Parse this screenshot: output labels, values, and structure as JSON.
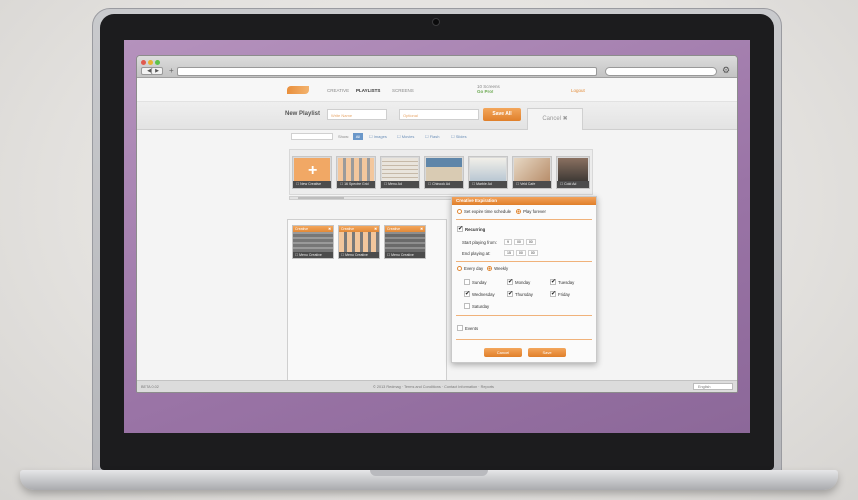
{
  "browser": {
    "nav_back": "◀",
    "nav_forward": "▶",
    "new_tab": "+",
    "settings_icon": "⚙"
  },
  "app_nav": {
    "items": [
      "CREATIVE",
      "PLAYLISTS",
      "SCREENS"
    ],
    "active": "PLAYLISTS",
    "user_line1": "10 Screens",
    "user_line2": "Go Pro!",
    "logout": "Logout"
  },
  "playlist_bar": {
    "label": "New Playlist",
    "name_placeholder": "Write Name",
    "desc_placeholder": "Optional",
    "save_label": "Save All",
    "cancel_label": "Cancel ✖"
  },
  "filter": {
    "search_placeholder": "Search",
    "show_label": "Show:",
    "all_label": "All",
    "items": [
      "☐ Images",
      "☐ Movies",
      "☐ Flash",
      "☐ Slides"
    ]
  },
  "thumbnails": [
    {
      "caption": "☐ New Creative",
      "kind": "add"
    },
    {
      "caption": "☐ 16 Spectre Grid",
      "kind": "grid"
    },
    {
      "caption": "☐ Menu Ad",
      "kind": "menu"
    },
    {
      "caption": "☐ Chinook Ad",
      "kind": "photo"
    },
    {
      "caption": "☐ Marble Ad",
      "kind": "text"
    },
    {
      "caption": "☐ Veld Cafe",
      "kind": "photo2"
    },
    {
      "caption": "☐ Cold Ad",
      "kind": "dark"
    }
  ],
  "playlist_tiles": [
    {
      "title": "Creative",
      "caption": "☐ Menu Creative"
    },
    {
      "title": "Creative",
      "caption": "☐ Menu Creative"
    },
    {
      "title": "Creative",
      "caption": "☐ Menu Creative"
    }
  ],
  "dialog": {
    "title": "Creative Expiration",
    "opt_expire": "Set expire time schedule",
    "opt_forever": "Play forever",
    "recurring": "Recurring",
    "start_label": "Start playing from:",
    "start_h": "9",
    "start_m": "00",
    "start_s": "00",
    "end_label": "End playing at:",
    "end_h": "15",
    "end_m": "00",
    "end_s": "00",
    "every_day": "Every day",
    "weekly": "Weekly",
    "days": [
      {
        "name": "Sunday",
        "checked": false
      },
      {
        "name": "Monday",
        "checked": true
      },
      {
        "name": "Tuesday",
        "checked": true
      },
      {
        "name": "Wednesday",
        "checked": true
      },
      {
        "name": "Thursday",
        "checked": true
      },
      {
        "name": "Friday",
        "checked": true
      },
      {
        "name": "Saturday",
        "checked": false
      }
    ],
    "events": "Events",
    "cancel_label": "Cancel",
    "save_label": "Save"
  },
  "under_buttons": [
    "Cancel",
    "Confirm"
  ],
  "footer": {
    "version": "BETA 0.02",
    "copyright": "© 2013 Redmag · Terms and Conditions · Contact Information · Reports",
    "language": "English"
  }
}
